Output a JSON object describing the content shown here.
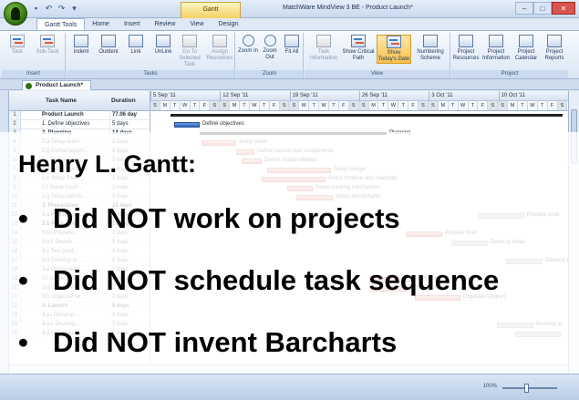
{
  "app": {
    "window_title": "MatchWare MindView 3 BE - Product Launch*",
    "context_tab": "Gantt",
    "colors": {
      "accent": "#f8c14a",
      "ribbon": "#dbe6f4",
      "bar_blue": "#2f64b9",
      "bar_pink": "#e5847a"
    }
  },
  "ribbon": {
    "tabs": [
      "Gantt Tools",
      "Home",
      "Insert",
      "Review",
      "View",
      "Design"
    ],
    "groups": [
      {
        "label": "Insert",
        "buttons": [
          {
            "label": "Task",
            "icon": "task-icon"
          },
          {
            "label": "Sub-Task",
            "icon": "subtask-icon"
          }
        ]
      },
      {
        "label": "Tasks",
        "buttons": [
          {
            "label": "Indent",
            "icon": "indent-icon"
          },
          {
            "label": "Outdent",
            "icon": "outdent-icon"
          },
          {
            "label": "Link",
            "icon": "link-icon"
          },
          {
            "label": "UnLink",
            "icon": "unlink-icon"
          },
          {
            "label": "Go To Selected Task",
            "icon": "goto-icon"
          },
          {
            "label": "Assign Resources",
            "icon": "assign-icon"
          }
        ]
      },
      {
        "label": "Zoom",
        "buttons": [
          {
            "label": "Zoom In",
            "icon": "zoom-in-icon"
          },
          {
            "label": "Zoom Out",
            "icon": "zoom-out-icon"
          },
          {
            "label": "Fit All",
            "icon": "fit-all-icon"
          }
        ]
      },
      {
        "label": "View",
        "buttons": [
          {
            "label": "Task Information",
            "icon": "task-info-icon"
          },
          {
            "label": "Show Critical Path",
            "icon": "critical-path-icon"
          },
          {
            "label": "Show Today's Date",
            "icon": "today-icon"
          },
          {
            "label": "Numbering Scheme",
            "icon": "numbering-icon"
          }
        ]
      },
      {
        "label": "Project",
        "buttons": [
          {
            "label": "Project Resources",
            "icon": "resources-icon"
          },
          {
            "label": "Project Information",
            "icon": "project-info-icon"
          },
          {
            "label": "Project Calendar",
            "icon": "calendar-icon"
          },
          {
            "label": "Project Reports",
            "icon": "reports-icon"
          }
        ]
      }
    ]
  },
  "document_tab": "Product Launch*",
  "grid": {
    "headers": {
      "task_name": "Task Name",
      "duration": "Duration"
    },
    "rows": [
      {
        "num": "1",
        "name": "Product Launch",
        "duration": "77.06 day",
        "summary": true
      },
      {
        "num": "2",
        "name": "1. Define objectives",
        "duration": "5 days"
      },
      {
        "num": "3",
        "name": "2. Planning",
        "duration": "14 days",
        "summary": true
      },
      {
        "num": "4",
        "name": "2.a Setup team",
        "duration": "2 days"
      },
      {
        "num": "5",
        "name": "2.b Define launch...",
        "duration": "3 days"
      },
      {
        "num": "6",
        "name": "2.c Define respo...",
        "duration": "2 days"
      },
      {
        "num": "7",
        "name": "2.d Setup budget",
        "duration": "3 days"
      },
      {
        "num": "8",
        "name": "2.e Setup timeli...",
        "duration": "2 days"
      },
      {
        "num": "9",
        "name": "2.f Setup tracki...",
        "duration": "2 days"
      },
      {
        "num": "10",
        "name": "2.g Setup bench...",
        "duration": "3 days"
      },
      {
        "num": "11",
        "name": "3. Preparation",
        "duration": "23 days",
        "summary": true
      },
      {
        "num": "12",
        "name": "3.a Prepare pro...",
        "duration": "4 days"
      },
      {
        "num": "13",
        "name": "3.b Packaging",
        "duration": "10 days",
        "summary": true
      },
      {
        "num": "14",
        "name": "3.b.i Prepare...",
        "duration": "2 days"
      },
      {
        "num": "15",
        "name": "3.b.ii Develo...",
        "duration": "3 days"
      },
      {
        "num": "16",
        "name": "3.c Test prod...",
        "duration": "4 days"
      },
      {
        "num": "17",
        "name": "3.d Develop pr...",
        "duration": "5 days"
      },
      {
        "num": "18",
        "name": "3.e Define learn...",
        "duration": "2 days"
      },
      {
        "num": "19",
        "name": "3.f Define fulfil...",
        "duration": "2 days"
      },
      {
        "num": "20",
        "name": "3.g Organize fu...",
        "duration": "2 days"
      },
      {
        "num": "21",
        "name": "3.h Organize su...",
        "duration": "2 days"
      },
      {
        "num": "22",
        "name": "4. Launch",
        "duration": "8 days",
        "summary": true
      },
      {
        "num": "23",
        "name": "4.a i Develop...",
        "duration": "3 days"
      },
      {
        "num": "24",
        "name": "4.a ii Develop...",
        "duration": "3 days"
      },
      {
        "num": "25",
        "name": "4.a iii Develo...",
        "duration": "5 days"
      }
    ]
  },
  "timescale": {
    "weeks": [
      "5 Sep '11",
      "12 Sep '11",
      "19 Sep '11",
      "26 Sep '11",
      "3 Oct '11",
      "10 Oct '11"
    ],
    "days": [
      "S",
      "M",
      "T",
      "W",
      "T",
      "F",
      "S",
      "S",
      "M",
      "T",
      "W",
      "T",
      "F",
      "S",
      "S",
      "M",
      "T",
      "W",
      "T",
      "F",
      "S",
      "S",
      "M",
      "T",
      "W",
      "T",
      "F",
      "S",
      "S",
      "M",
      "T",
      "W",
      "T",
      "F",
      "S",
      "S",
      "M",
      "T",
      "W",
      "T",
      "F",
      "S"
    ]
  },
  "gantt_labels": {
    "define_objectives": "Define objectives",
    "planning": "Planning",
    "setup_team": "Setup team",
    "define_launch": "Define launch plan components",
    "define_resp": "Define responsibilities",
    "setup_budget": "Setup budget",
    "setup_timeline": "Setup timeline and roadmap",
    "setup_tracking": "Setup tracking mechanism",
    "setup_bench": "Setup benchmarks",
    "prepare_prod": "Prepare prod",
    "prepare_brief": "Prepare brief",
    "develop_ideas": "Develop ideas",
    "develop_pr": "Develop pr",
    "define_learning": "Define learning policies",
    "define_fulfilment": "Define fulfilment",
    "organize_support": "Organize support",
    "develop_la": "Develop la"
  },
  "status": {
    "zoom": "100%"
  },
  "slide_overlay": {
    "heading": "Henry L. Gantt:",
    "bullet_char": "•",
    "bullets": [
      "Did NOT work on projects",
      "Did NOT schedule task sequence",
      "Did NOT invent Barcharts"
    ]
  }
}
